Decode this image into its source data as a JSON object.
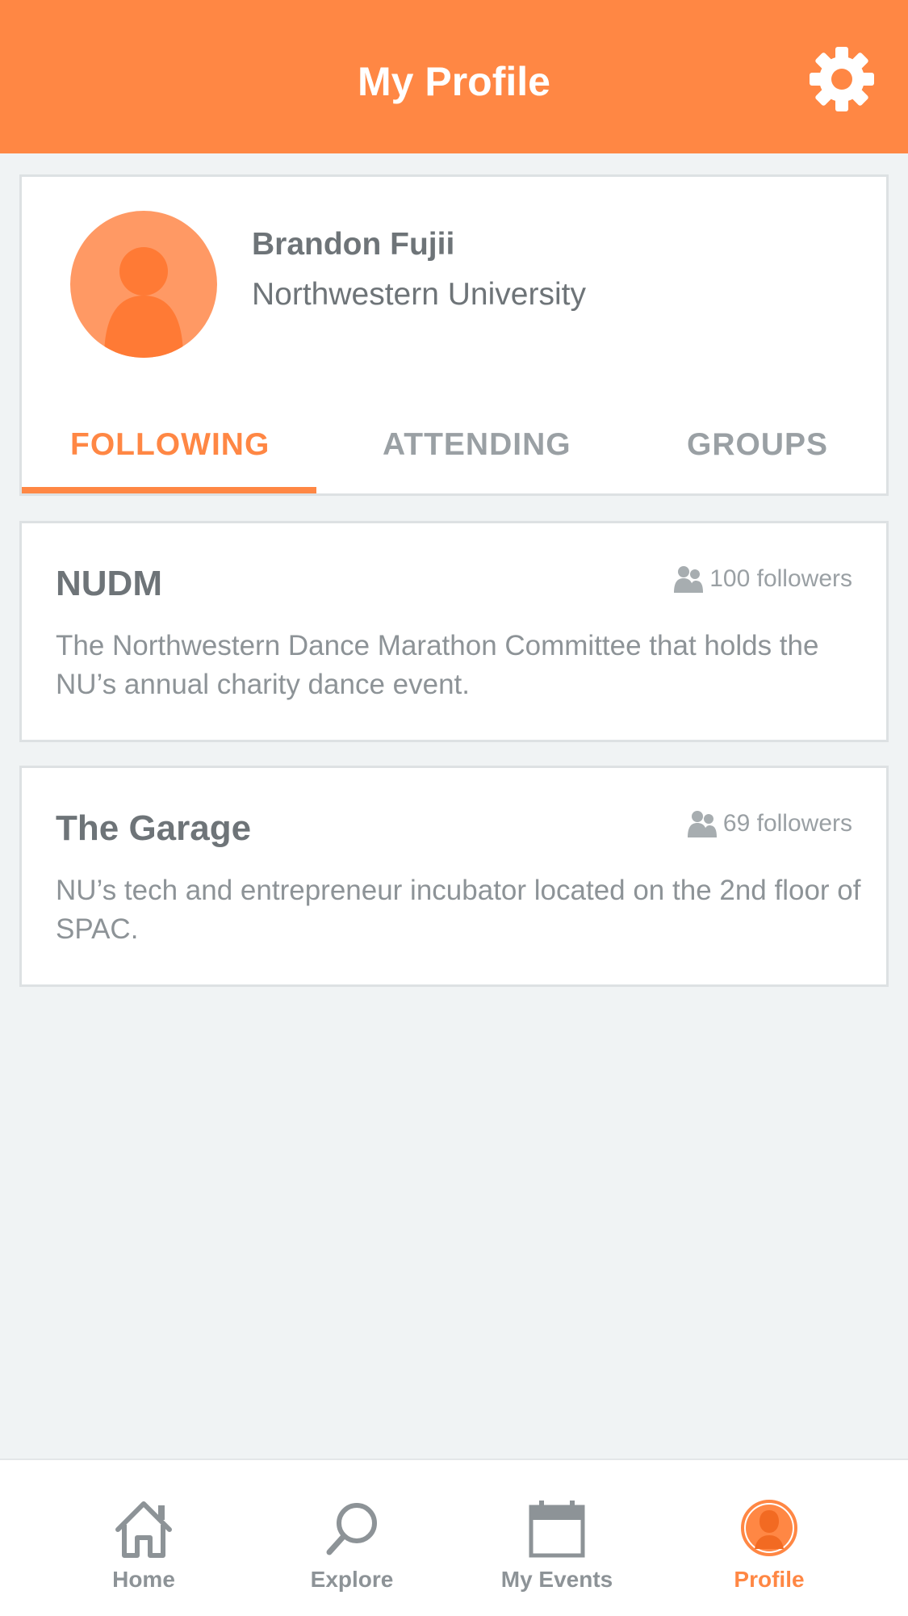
{
  "header": {
    "title": "My Profile",
    "settings_icon": "gear-icon"
  },
  "profile": {
    "name": "Brandon Fujii",
    "school": "Northwestern University"
  },
  "tabs": [
    {
      "label": "FOLLOWING",
      "active": true
    },
    {
      "label": "ATTENDING",
      "active": false
    },
    {
      "label": "GROUPS",
      "active": false
    }
  ],
  "groups": [
    {
      "name": "NUDM",
      "followers": "100 followers",
      "description": "The Northwestern Dance Marathon Committee that holds the NU’s annual charity dance event."
    },
    {
      "name": "The Garage",
      "followers": "69 followers",
      "description": "NU’s tech and entrepreneur incubator located on the 2nd floor of SPAC."
    }
  ],
  "nav": [
    {
      "label": "Home",
      "icon": "home-icon",
      "active": false
    },
    {
      "label": "Explore",
      "icon": "search-icon",
      "active": false
    },
    {
      "label": "My Events",
      "icon": "calendar-icon",
      "active": false
    },
    {
      "label": "Profile",
      "icon": "profile-icon",
      "active": true
    }
  ],
  "colors": {
    "accent": "#ff8744",
    "background": "#f0f3f4",
    "text": "#6e7478"
  }
}
